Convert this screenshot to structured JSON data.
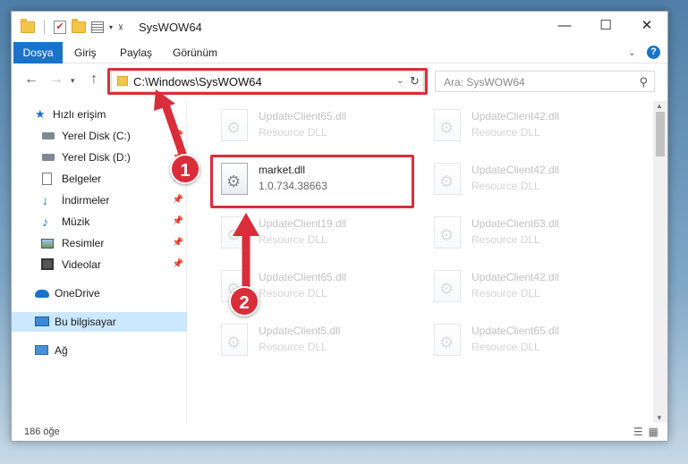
{
  "window": {
    "title": "SysWOW64",
    "controls": {
      "minimize": "—",
      "maximize": "☐",
      "close": "✕"
    }
  },
  "ribbon": {
    "file_tab": "Dosya",
    "tabs": [
      "Giriş",
      "Paylaş",
      "Görünüm"
    ],
    "help": "?"
  },
  "address": {
    "path": "C:\\Windows\\SysWOW64",
    "search_placeholder": "Ara: SysWOW64"
  },
  "sidebar": {
    "items": [
      {
        "label": "Hızlı erişim",
        "icon": "star-icon",
        "pinned": false
      },
      {
        "label": "Yerel Disk (C:)",
        "icon": "drive-icon",
        "pinned": true
      },
      {
        "label": "Yerel Disk (D:)",
        "icon": "drive-icon",
        "pinned": true
      },
      {
        "label": "Belgeler",
        "icon": "document-icon",
        "pinned": true
      },
      {
        "label": "İndirmeler",
        "icon": "download-icon",
        "pinned": true
      },
      {
        "label": "Müzik",
        "icon": "music-icon",
        "pinned": true
      },
      {
        "label": "Resimler",
        "icon": "pictures-icon",
        "pinned": true
      },
      {
        "label": "Videolar",
        "icon": "video-icon",
        "pinned": true
      },
      {
        "label": "OneDrive",
        "icon": "cloud-icon",
        "pinned": false
      },
      {
        "label": "Bu bilgisayar",
        "icon": "computer-icon",
        "pinned": false,
        "selected": true
      },
      {
        "label": "Ağ",
        "icon": "network-icon",
        "pinned": false
      }
    ]
  },
  "files": {
    "left": [
      {
        "name": "UpdateClient65.dll",
        "type": "Resource DLL"
      },
      {
        "name": "market.dll",
        "type": "1.0.734.38663",
        "highlighted": true
      },
      {
        "name": "UpdateClient19.dll",
        "type": "Resource DLL"
      },
      {
        "name": "UpdateClient65.dll",
        "type": "Resource DLL"
      },
      {
        "name": "UpdateClient5.dll",
        "type": "Resource DLL"
      }
    ],
    "right": [
      {
        "name": "UpdateClient42.dll",
        "type": "Resource DLL"
      },
      {
        "name": "UpdateClient42.dll",
        "type": "Resource DLL"
      },
      {
        "name": "UpdateClient63.dll",
        "type": "Resource DLL"
      },
      {
        "name": "UpdateClient42.dll",
        "type": "Resource DLL"
      },
      {
        "name": "UpdateClient65.dll",
        "type": "Resource DLL"
      }
    ]
  },
  "status": {
    "count": "186 öğe"
  },
  "annotations": {
    "badge1": "1",
    "badge2": "2",
    "color": "#d92e3a"
  }
}
